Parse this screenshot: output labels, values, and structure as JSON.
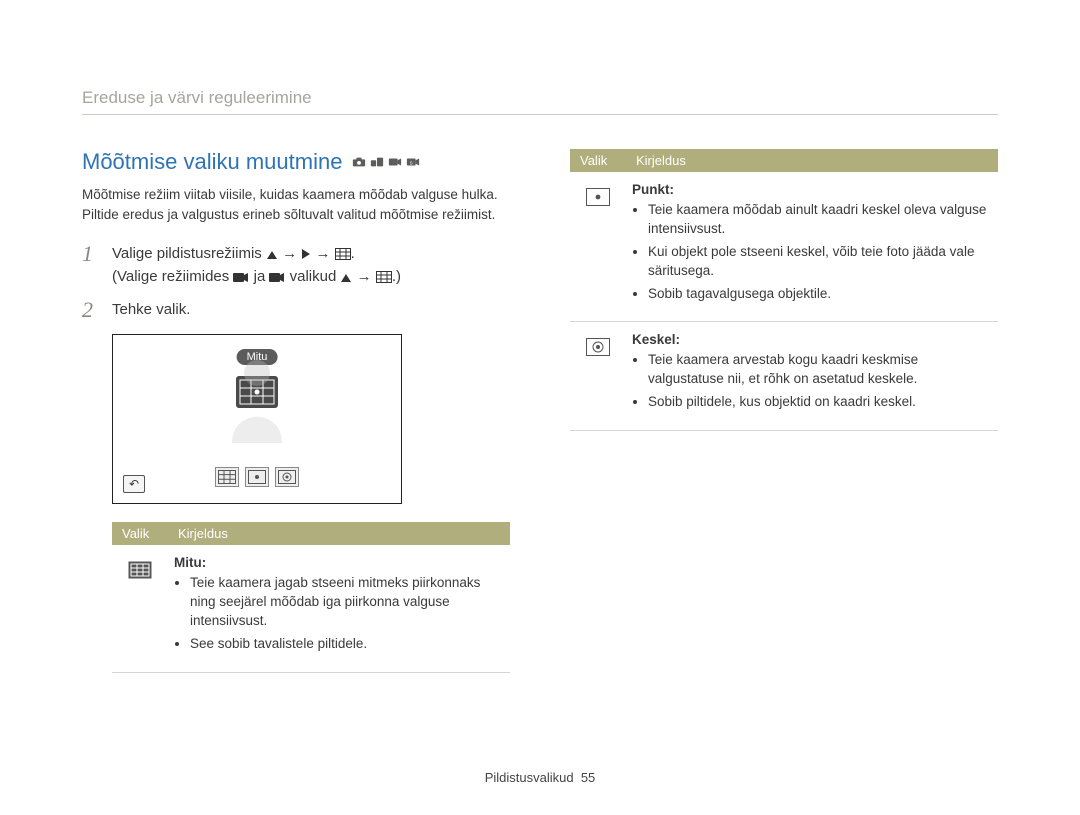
{
  "header": "Ereduse ja värvi reguleerimine",
  "title": "Mõõtmise valiku muutmine",
  "intro": "Mõõtmise režiim viitab viisile, kuidas kaamera mõõdab valguse hulka. Piltide eredus ja valgustus erineb sõltuvalt valitud mõõtmise režiimist.",
  "step1_a": "Valige pildistusrežiimis ",
  "step1_b": "(Valige režiimides ",
  "step1_c": " ja ",
  "step1_d": " valikud ",
  "step2": "Tehke valik.",
  "mitu_label": "Mitu",
  "table_head_option": "Valik",
  "table_head_desc": "Kirjeldus",
  "options": {
    "mitu": {
      "name": "Mitu",
      "b1": "Teie kaamera jagab stseeni mitmeks piirkonnaks ning seejärel mõõdab iga piirkonna valguse intensiivsust.",
      "b2": "See sobib tavalistele piltidele."
    },
    "punkt": {
      "name": "Punkt",
      "b1": "Teie kaamera mõõdab ainult kaadri keskel oleva valguse intensiivsust.",
      "b2": "Kui objekt pole stseeni keskel, võib teie foto jääda vale säritusega.",
      "b3": "Sobib tagavalgusega objektile."
    },
    "keskel": {
      "name": "Keskel",
      "b1": "Teie kaamera arvestab kogu kaadri keskmise valgustatuse nii, et rõhk on asetatud keskele.",
      "b2": "Sobib piltidele, kus objektid on kaadri keskel."
    }
  },
  "footer": {
    "section": "Pildistusvalikud",
    "page": "55"
  }
}
